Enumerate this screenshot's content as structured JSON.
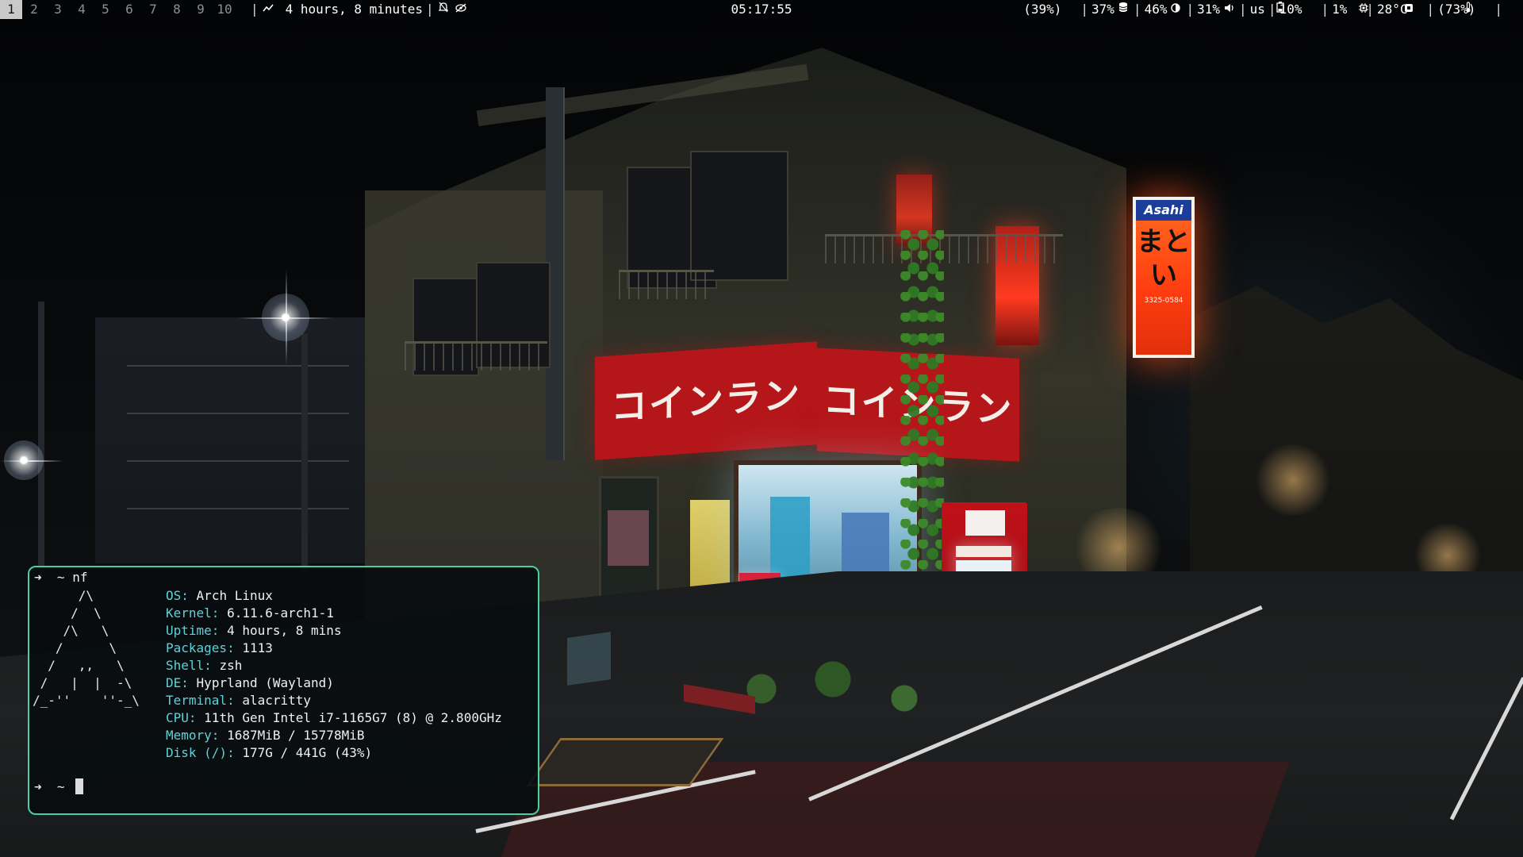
{
  "topbar": {
    "workspaces": [
      "1",
      "2",
      "3",
      "4",
      "5",
      "6",
      "7",
      "8",
      "9",
      "10"
    ],
    "active_workspace": "1",
    "uptime": "4 hours, 8 minutes",
    "clock": "05:17:55",
    "modules": {
      "storage": "(39%)",
      "brightness": "37%",
      "volume": "46%",
      "battery": "31%",
      "keyboard_layout": "us",
      "cpu": "10%",
      "memory": "1%",
      "temperature": "28°C",
      "wifi": "(73%)"
    },
    "separator": "|"
  },
  "wallpaper": {
    "sign_left": "コインランドリー",
    "sign_right": "コインランドリー",
    "asahi_brand": "Asahi",
    "asahi_kanji": "まとい",
    "asahi_number": "3325-0584"
  },
  "terminal": {
    "prompt_symbol": "➜",
    "cwd": "~",
    "command": "nf",
    "ascii_logo": "      /\\\n     /  \\\n    /\\   \\\n   /      \\\n  /   ,,   \\\n /   |  |  -\\\n/_-''    ''-_\\",
    "fastfetch": [
      {
        "key": "OS:",
        "value": "Arch Linux"
      },
      {
        "key": "Kernel:",
        "value": "6.11.6-arch1-1"
      },
      {
        "key": "Uptime:",
        "value": "4 hours, 8 mins"
      },
      {
        "key": "Packages:",
        "value": "1113"
      },
      {
        "key": "Shell:",
        "value": "zsh"
      },
      {
        "key": "DE:",
        "value": "Hyprland (Wayland)"
      },
      {
        "key": "Terminal:",
        "value": "alacritty"
      },
      {
        "key": "CPU:",
        "value": "11th Gen Intel i7-1165G7 (8) @ 2.800GHz"
      },
      {
        "key": "Memory:",
        "value": "1687MiB / 15778MiB"
      },
      {
        "key": "Disk (/):",
        "value": "177G / 441G (43%)"
      }
    ]
  },
  "colors": {
    "terminal_border": "#45d0a6",
    "info_key": "#5fd2d8",
    "active_workspace_bg": "#c9c9c9"
  }
}
